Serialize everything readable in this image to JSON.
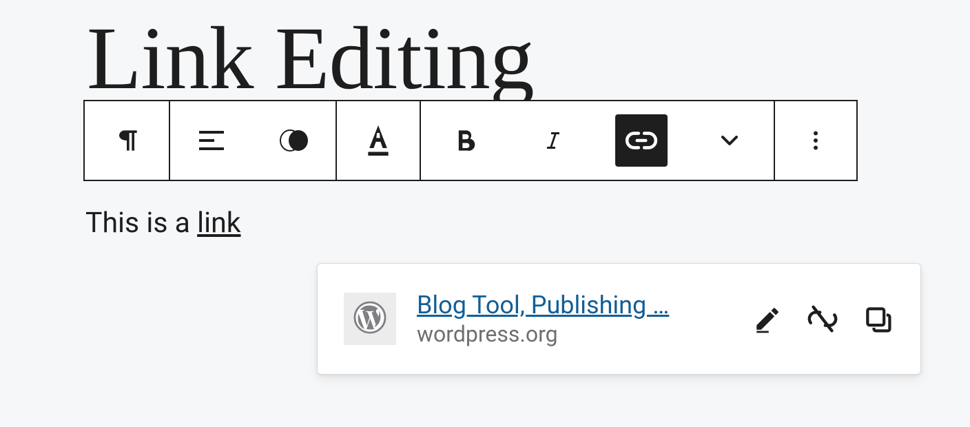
{
  "title": "Link Editing",
  "paragraph": {
    "prefix": "This is a ",
    "link_text": "link"
  },
  "toolbar": {
    "block_type": "paragraph",
    "link_active": true
  },
  "link_popover": {
    "title": "Blog Tool, Publishing …",
    "domain": "wordpress.org"
  }
}
